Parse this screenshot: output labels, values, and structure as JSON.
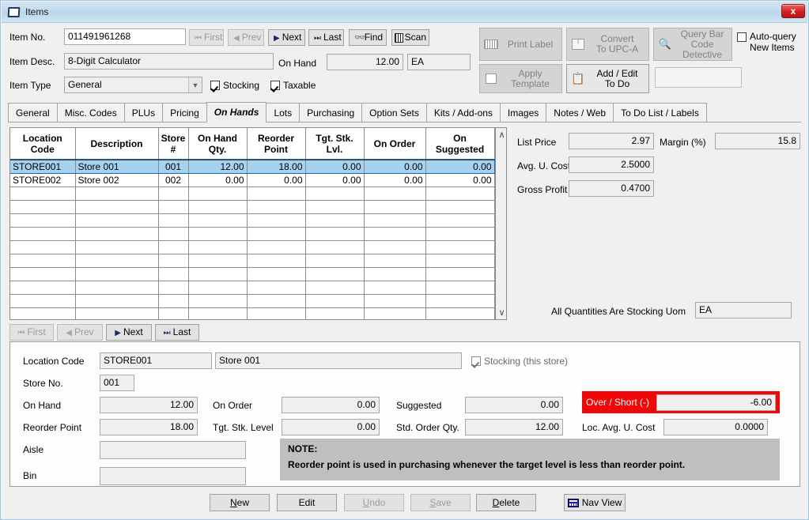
{
  "window": {
    "title": "Items",
    "close_label": "x"
  },
  "header": {
    "item_no_label": "Item No.",
    "item_no_value": "011491961268",
    "item_desc_label": "Item Desc.",
    "item_desc_value": "8-Digit Calculator",
    "item_type_label": "Item Type",
    "item_type_value": "General",
    "on_hand_label": "On Hand",
    "on_hand_value": "12.00",
    "on_hand_uom": "EA",
    "stocking_label": "Stocking",
    "taxable_label": "Taxable",
    "nav": {
      "first": "First",
      "prev": "Prev",
      "next": "Next",
      "last": "Last",
      "find": "Find",
      "scan": "Scan"
    },
    "actions": {
      "print_label": "Print Label",
      "convert_l1": "Convert",
      "convert_l2": "To UPC-A",
      "query_l1": "Query Bar",
      "query_l2": "Code Detective",
      "apply_l1": "Apply",
      "apply_l2": "Template",
      "addedit_l1": "Add / Edit",
      "addedit_l2": "To Do",
      "blank_value": ""
    },
    "autoquery_l1": "Auto-query",
    "autoquery_l2": "New Items"
  },
  "tabs": [
    {
      "label": "General",
      "active": false
    },
    {
      "label": "Misc. Codes",
      "active": false
    },
    {
      "label": "PLUs",
      "active": false
    },
    {
      "label": "Pricing",
      "active": false
    },
    {
      "label": "On Hands",
      "active": true
    },
    {
      "label": "Lots",
      "active": false
    },
    {
      "label": "Purchasing",
      "active": false
    },
    {
      "label": "Option Sets",
      "active": false
    },
    {
      "label": "Kits / Add-ons",
      "active": false
    },
    {
      "label": "Images",
      "active": false
    },
    {
      "label": "Notes / Web",
      "active": false
    },
    {
      "label": "To Do List / Labels",
      "active": false
    }
  ],
  "grid": {
    "columns": [
      {
        "l1": "Location",
        "l2": "Code"
      },
      {
        "l1": "Description",
        "l2": ""
      },
      {
        "l1": "Store",
        "l2": "#"
      },
      {
        "l1": "On Hand",
        "l2": "Qty."
      },
      {
        "l1": "Reorder",
        "l2": "Point"
      },
      {
        "l1": "Tgt. Stk.",
        "l2": "Lvl."
      },
      {
        "l1": "On Order",
        "l2": ""
      },
      {
        "l1": "On",
        "l2": "Suggested"
      }
    ],
    "rows": [
      {
        "selected": true,
        "cells": [
          "STORE001",
          "Store 001",
          "001",
          "12.00",
          "18.00",
          "0.00",
          "0.00",
          "0.00"
        ]
      },
      {
        "selected": false,
        "cells": [
          "STORE002",
          "Store 002",
          "002",
          "0.00",
          "0.00",
          "0.00",
          "0.00",
          "0.00"
        ]
      }
    ],
    "empty_row_count": 11,
    "nav": {
      "first": "First",
      "prev": "Prev",
      "next": "Next",
      "last": "Last"
    },
    "scroll_up": "∧",
    "scroll_down": "∨"
  },
  "prices": {
    "list_price_label": "List Price",
    "list_price_value": "2.97",
    "margin_label": "Margin (%)",
    "margin_value": "15.8",
    "avg_cost_label": "Avg. U. Cost",
    "avg_cost_value": "2.5000",
    "gross_profit_label": "Gross Profit",
    "gross_profit_value": "0.4700",
    "all_qty_label": "All Quantities Are Stocking Uom",
    "all_qty_value": "EA"
  },
  "detail": {
    "location_code_label": "Location Code",
    "location_code_value": "STORE001",
    "location_desc_value": "Store 001",
    "stocking_this_store_label": "Stocking (this store)",
    "store_no_label": "Store No.",
    "store_no_value": "001",
    "on_hand_label": "On Hand",
    "on_hand_value": "12.00",
    "on_order_label": "On Order",
    "on_order_value": "0.00",
    "suggested_label": "Suggested",
    "suggested_value": "0.00",
    "reorder_point_label": "Reorder Point",
    "reorder_point_value": "18.00",
    "tgt_stk_level_label": "Tgt. Stk. Level",
    "tgt_stk_level_value": "0.00",
    "std_order_qty_label": "Std. Order Qty.",
    "std_order_qty_value": "12.00",
    "over_short_label": "Over / Short (-)",
    "over_short_value": "-6.00",
    "over_short_color": "#ee0808",
    "loc_avg_cost_label": "Loc. Avg. U. Cost",
    "loc_avg_cost_value": "0.0000",
    "aisle_label": "Aisle",
    "aisle_value": "",
    "bin_label": "Bin",
    "bin_value": "",
    "note_title": "NOTE:",
    "note_text": "Reorder point is used in purchasing whenever the target level is less than reorder point."
  },
  "footer": {
    "new": "New",
    "edit": "Edit",
    "undo": "Undo",
    "save": "Save",
    "delete": "Delete",
    "nav_view": "Nav View"
  }
}
